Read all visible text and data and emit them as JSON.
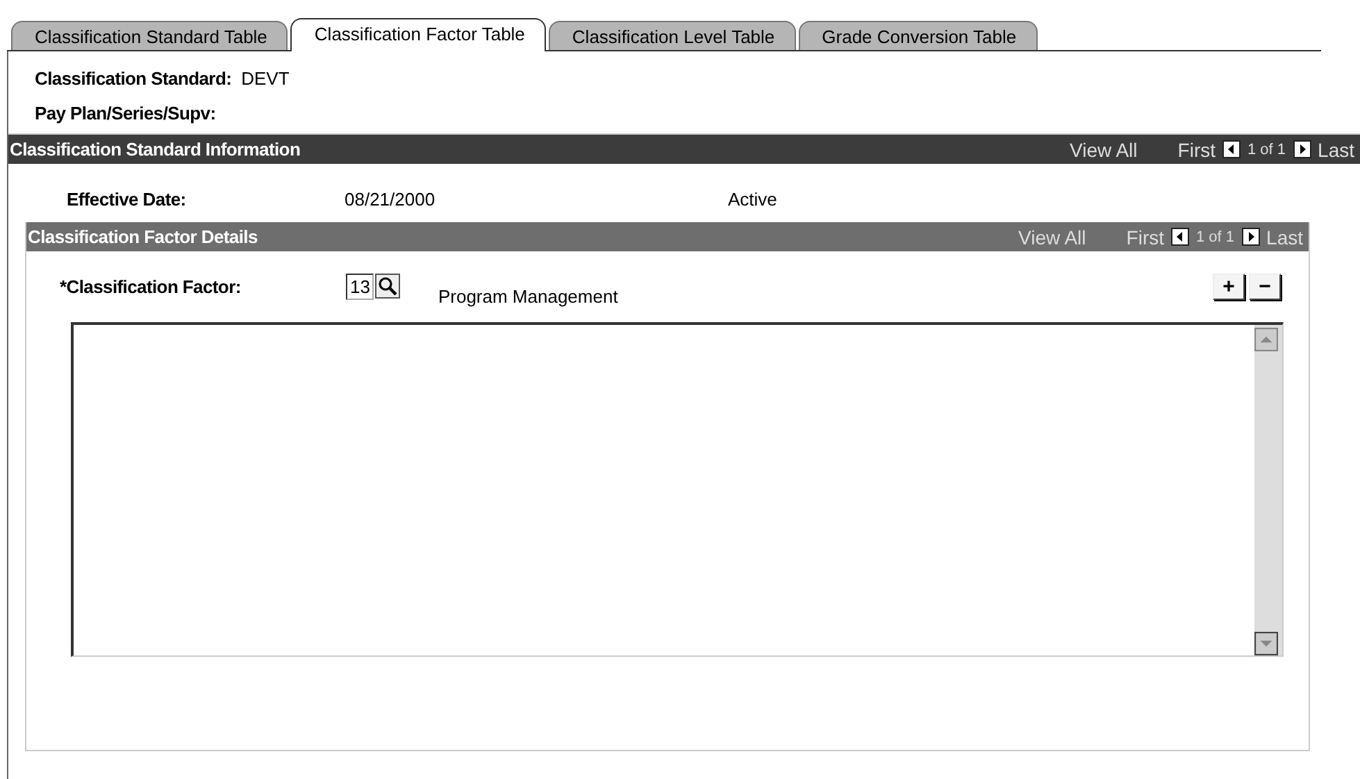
{
  "tabs": [
    {
      "label": "Classification Standard Table",
      "selected": false
    },
    {
      "label": "Classification Factor Table",
      "selected": true
    },
    {
      "label": "Classification Level Table",
      "selected": false
    },
    {
      "label": "Grade Conversion Table",
      "selected": false
    }
  ],
  "header_fields": [
    {
      "label": "Classification Standard:",
      "value": "DEVT"
    },
    {
      "label": "Pay Plan/Series/Supv:"
    }
  ],
  "standard_section": {
    "title": "Classification Standard Information",
    "view_all": "View All",
    "first": "First",
    "count": "1 of 1",
    "last": "Last",
    "effective_date_label": "Effective Date:",
    "effective_date": "08/21/2000",
    "status": "Active"
  },
  "factor_section": {
    "title": "Classification Factor Details",
    "view_all": "View All",
    "first": "First",
    "count": "1 of 1",
    "last": "Last",
    "factor_label": "*Classification Factor:",
    "factor_value": "13",
    "factor_description": "Program Management",
    "add_button": "+",
    "remove_button": "−"
  }
}
